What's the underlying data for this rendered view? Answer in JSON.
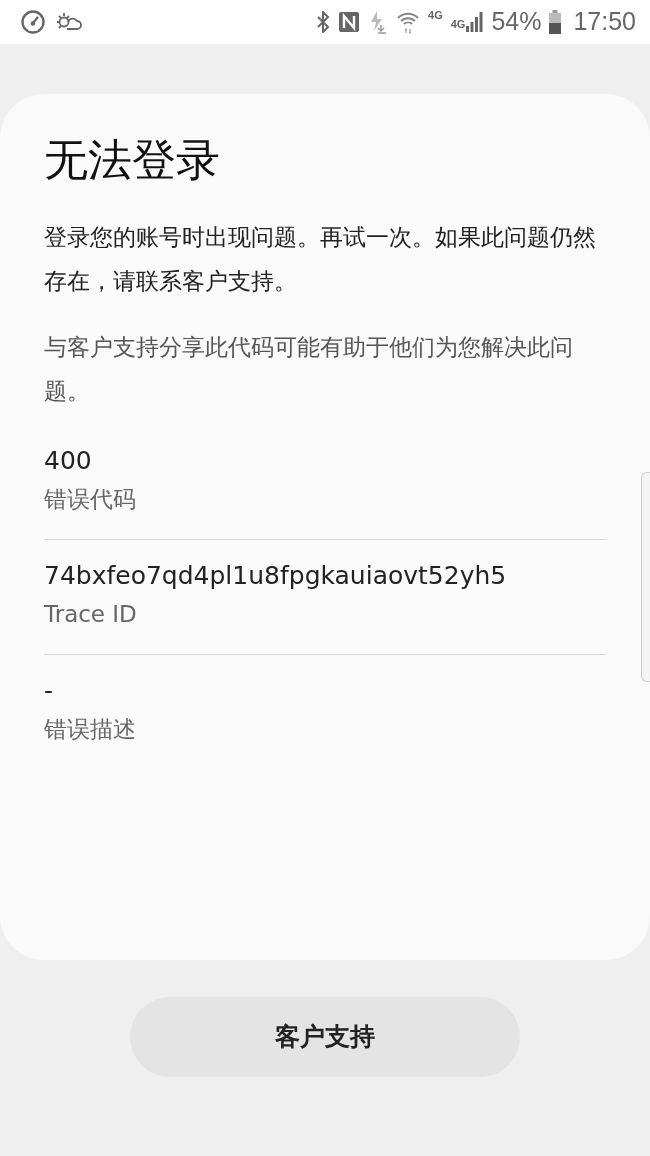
{
  "status_bar": {
    "network_label": "4G",
    "signal_label": "4G",
    "battery": "54%",
    "time": "17:50"
  },
  "dialog": {
    "title": "无法登录",
    "message": "登录您的账号时出现问题。再试一次。如果此问题仍然存在，请联系客户支持。",
    "hint": "与客户支持分享此代码可能有助于他们为您解决此问题。",
    "fields": [
      {
        "value": "400",
        "label": "错误代码"
      },
      {
        "value": "74bxfeo7qd4pl1u8fpgkauiaovt52yh5",
        "label": "Trace ID"
      },
      {
        "value": "-",
        "label": "错误描述"
      }
    ]
  },
  "button": "客户支持"
}
